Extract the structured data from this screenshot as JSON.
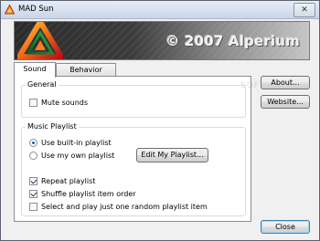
{
  "window": {
    "title": "MAD Sun",
    "close_glyph": "✕"
  },
  "banner": {
    "copyright": "© 2007 Alperium",
    "logo_icon": "triangle-logo-icon"
  },
  "tabs": [
    {
      "label": "Sound",
      "active": true
    },
    {
      "label": "Behavior",
      "active": false
    }
  ],
  "general": {
    "legend": "General",
    "mute_label": "Mute sounds",
    "mute_checked": false
  },
  "playlist": {
    "legend": "Music Playlist",
    "builtin_label": "Use built-in playlist",
    "own_label": "Use my own playlist",
    "selected": "builtin",
    "edit_button": "Edit My Playlist...",
    "repeat_label": "Repeat playlist",
    "repeat_checked": true,
    "shuffle_label": "Shuffle playlist item order",
    "shuffle_checked": true,
    "random_label": "Select and play just one random playlist item",
    "random_checked": false
  },
  "side_buttons": {
    "about": "About...",
    "website": "Website...",
    "close": "Close"
  },
  "watermark": "SOFTPEDIA"
}
